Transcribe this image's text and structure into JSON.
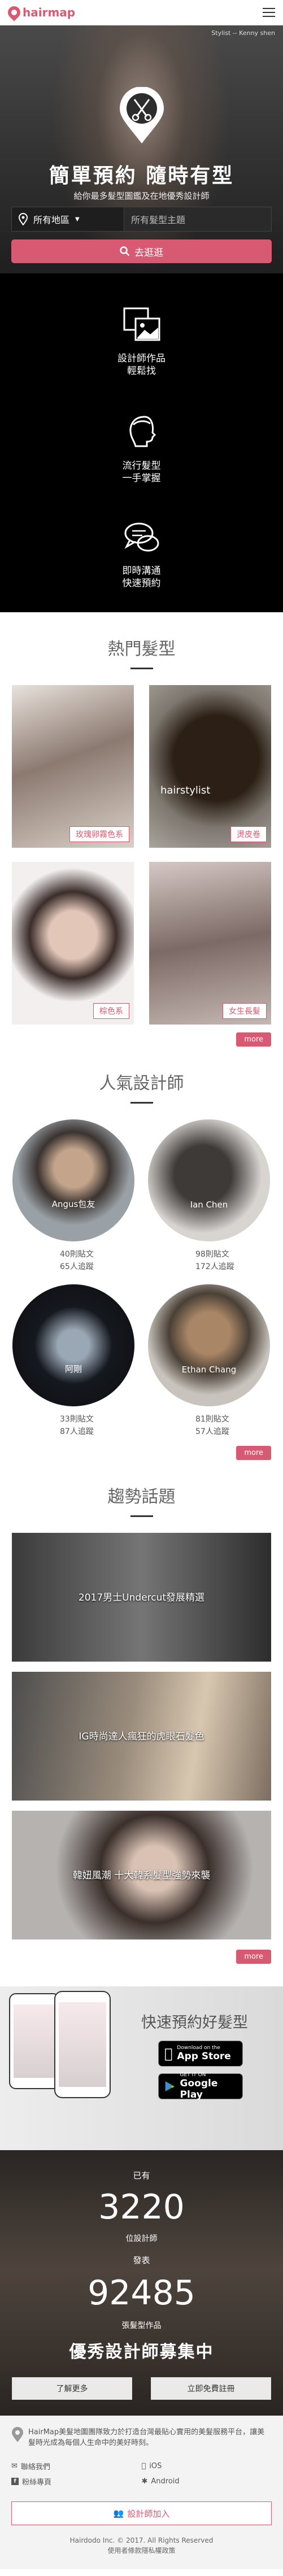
{
  "header": {
    "logo_text": "hairmap",
    "menu_icon": "hamburger-menu-icon"
  },
  "hero": {
    "credit": "Stylist -- Kenny shen",
    "title": "簡單預約 隨時有型",
    "subtitle": "給你最多髮型圖鑑及在地優秀設計師",
    "region_select": "所有地區",
    "keyword_placeholder": "所有髮型主題",
    "search_button": "去逛逛"
  },
  "features": [
    {
      "line1": "設計師作品",
      "line2": "輕鬆找",
      "icon": "gallery-icon"
    },
    {
      "line1": "流行髮型",
      "line2": "一手掌握",
      "icon": "hair-profile-icon"
    },
    {
      "line1": "即時溝通",
      "line2": "快速預約",
      "icon": "chat-bubbles-icon"
    }
  ],
  "hot_styles": {
    "title": "熱門髮型",
    "items": [
      {
        "label": "玫瑰卵霧色系"
      },
      {
        "label": "燙皮卷",
        "overlay": "hairstylist"
      },
      {
        "label": "棕色系"
      },
      {
        "label": "女生長髮"
      }
    ],
    "more": "more"
  },
  "designers": {
    "title": "人氣設計師",
    "items": [
      {
        "name": "Angus包友",
        "posts": "40則貼文",
        "fans": "65人追蹤"
      },
      {
        "name": "Ian Chen",
        "posts": "98則貼文",
        "fans": "172人追蹤"
      },
      {
        "name": "阿剛",
        "posts": "33則貼文",
        "fans": "87人追蹤"
      },
      {
        "name": "Ethan Chang",
        "posts": "81則貼文",
        "fans": "57人追蹤"
      }
    ],
    "more": "more"
  },
  "topics": {
    "title": "趨勢話題",
    "items": [
      {
        "title": "2017男士Undercut發展精選"
      },
      {
        "title": "IG時尚達人瘋狂的虎眼石髮色"
      },
      {
        "title": "韓妞風潮 十大韓系髮型強勢來襲"
      }
    ],
    "more": "more"
  },
  "app": {
    "title": "快速預約好髮型",
    "appstore_small": "Download on the",
    "appstore_big": "App Store",
    "google_small": "GET IT ON",
    "google_big": "Google Play"
  },
  "stats": {
    "have": "已有",
    "designers_count": "3220",
    "designers_label": "位設計師",
    "published": "發表",
    "works_count": "92485",
    "works_label": "張髮型作品",
    "recruit": "優秀設計師募集中",
    "learn_more": "了解更多",
    "register": "立即免費註冊"
  },
  "footer": {
    "about": "HairMap美髮地圖團隊致力於打造台灣最貼心實用的美髮服務平台，讓美髮時光成為每個人生命中的美好時刻。",
    "links": [
      {
        "label": "聯絡我們",
        "icon": "mail-icon"
      },
      {
        "label": "iOS",
        "icon": "apple-icon"
      },
      {
        "label": "粉絲專頁",
        "icon": "facebook-icon"
      },
      {
        "label": "Android",
        "icon": "android-icon"
      }
    ],
    "join_button": "設計師加入",
    "copyright": "Hairdodo Inc. © 2017. All Rights Reserved",
    "terms": "使用者條款隱私權政策"
  },
  "colors": {
    "accent": "#d85a72",
    "dark": "#000000"
  }
}
